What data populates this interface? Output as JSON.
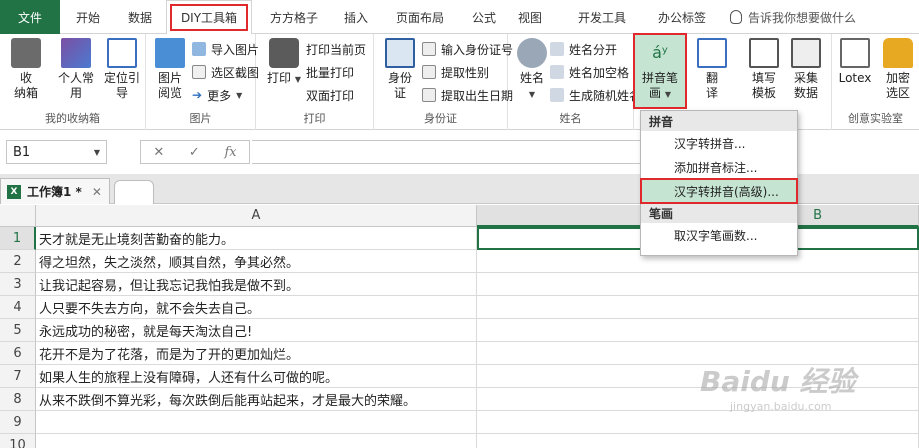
{
  "tabs": {
    "file": "文件",
    "items": [
      "开始",
      "数据",
      "DIY工具箱",
      "方方格子",
      "插入",
      "页面布局",
      "公式",
      "视图",
      "开发工具",
      "办公标签"
    ],
    "tell_me": "告诉我你想要做什么"
  },
  "ribbon": {
    "my_box": {
      "label": "我的收纳箱",
      "storage": "收\n纳箱",
      "personal": "个人常\n用",
      "locate": "定位引\n导"
    },
    "picture": {
      "label": "图片",
      "view": "图片\n阅览",
      "import": "导入图片",
      "screenshot": "选区截图",
      "more": "更多"
    },
    "print": {
      "label": "打印",
      "print": "打印",
      "current_page": "打印当前页",
      "batch": "批量打印",
      "duplex": "双面打印"
    },
    "idcard": {
      "label": "身份证",
      "id": "身份\n证",
      "input": "输入身份证号",
      "gender": "提取性别",
      "birthday": "提取出生日期"
    },
    "name": {
      "label": "姓名",
      "name": "姓名",
      "split": "姓名分开",
      "space": "姓名加空格",
      "random": "生成随机姓名"
    },
    "pinyin": {
      "label": "拼音笔\n画"
    },
    "translate": {
      "label": "翻\n译"
    },
    "fill_template": {
      "label": "填写\n模板"
    },
    "collect": {
      "label": "采集\n数据"
    },
    "lotex": {
      "label": "Lotex"
    },
    "encrypt": {
      "label": "加密\n选区"
    },
    "lab": {
      "label": "创意实验室"
    }
  },
  "dropdown": {
    "section1": "拼音",
    "item1": "汉字转拼音...",
    "item2": "添加拼音标注...",
    "item3": "汉字转拼音(高级)...",
    "section2": "笔画",
    "item4": "取汉字笔画数..."
  },
  "formula_bar": {
    "name_box": "B1",
    "fx": "fx"
  },
  "workbook": {
    "tab": "工作簿1 *"
  },
  "grid": {
    "columns": [
      "A",
      "B"
    ],
    "rows": [
      {
        "num": "1",
        "a": "天才就是无止境刻苦勤奋的能力。"
      },
      {
        "num": "2",
        "a": "得之坦然，失之淡然，顺其自然，争其必然。"
      },
      {
        "num": "3",
        "a": "让我记起容易，但让我忘记我怕我是做不到。"
      },
      {
        "num": "4",
        "a": "人只要不失去方向，就不会失去自己。"
      },
      {
        "num": "5",
        "a": "永远成功的秘密，就是每天淘汰自己!"
      },
      {
        "num": "6",
        "a": "花开不是为了花落，而是为了开的更加灿烂。"
      },
      {
        "num": "7",
        "a": "如果人生的旅程上没有障碍，人还有什么可做的呢。"
      },
      {
        "num": "8",
        "a": "从来不跌倒不算光彩，每次跌倒后能再站起来，才是最大的荣耀。"
      },
      {
        "num": "9",
        "a": ""
      },
      {
        "num": "10",
        "a": ""
      }
    ]
  },
  "watermark": {
    "brand": "Baidu 经验",
    "url": "jingyan.baidu.com"
  },
  "colors": {
    "excel_green": "#217346",
    "highlight_red": "#e0292c"
  }
}
